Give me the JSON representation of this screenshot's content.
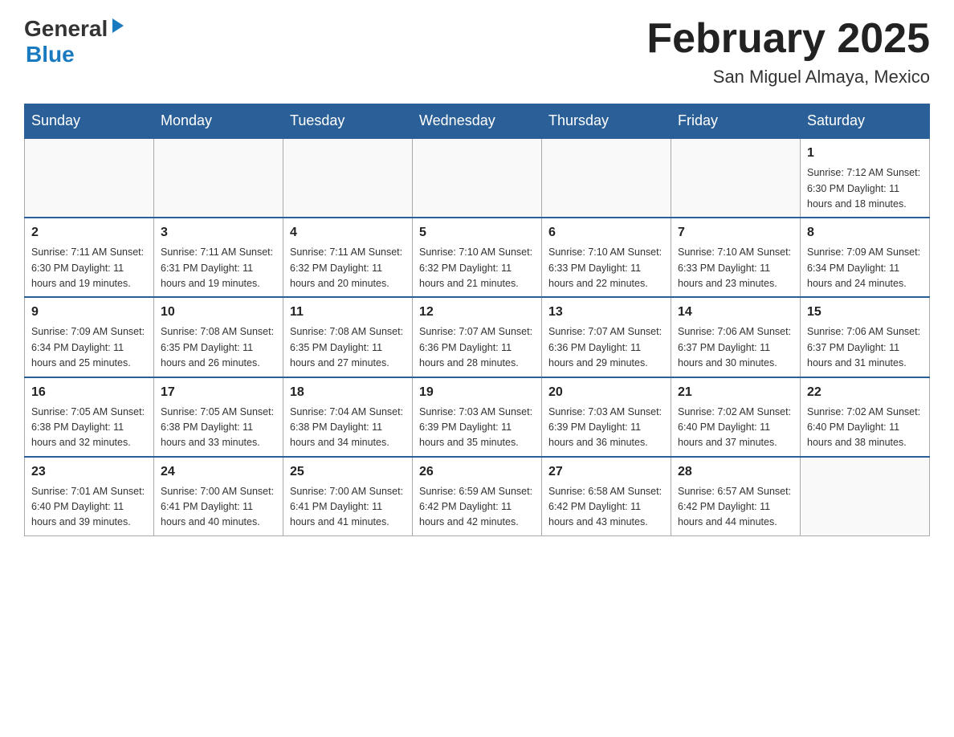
{
  "header": {
    "logo": {
      "general": "General",
      "blue": "Blue"
    },
    "title": "February 2025",
    "location": "San Miguel Almaya, Mexico"
  },
  "days_of_week": [
    "Sunday",
    "Monday",
    "Tuesday",
    "Wednesday",
    "Thursday",
    "Friday",
    "Saturday"
  ],
  "weeks": [
    [
      {
        "day": "",
        "info": ""
      },
      {
        "day": "",
        "info": ""
      },
      {
        "day": "",
        "info": ""
      },
      {
        "day": "",
        "info": ""
      },
      {
        "day": "",
        "info": ""
      },
      {
        "day": "",
        "info": ""
      },
      {
        "day": "1",
        "info": "Sunrise: 7:12 AM\nSunset: 6:30 PM\nDaylight: 11 hours and 18 minutes."
      }
    ],
    [
      {
        "day": "2",
        "info": "Sunrise: 7:11 AM\nSunset: 6:30 PM\nDaylight: 11 hours and 19 minutes."
      },
      {
        "day": "3",
        "info": "Sunrise: 7:11 AM\nSunset: 6:31 PM\nDaylight: 11 hours and 19 minutes."
      },
      {
        "day": "4",
        "info": "Sunrise: 7:11 AM\nSunset: 6:32 PM\nDaylight: 11 hours and 20 minutes."
      },
      {
        "day": "5",
        "info": "Sunrise: 7:10 AM\nSunset: 6:32 PM\nDaylight: 11 hours and 21 minutes."
      },
      {
        "day": "6",
        "info": "Sunrise: 7:10 AM\nSunset: 6:33 PM\nDaylight: 11 hours and 22 minutes."
      },
      {
        "day": "7",
        "info": "Sunrise: 7:10 AM\nSunset: 6:33 PM\nDaylight: 11 hours and 23 minutes."
      },
      {
        "day": "8",
        "info": "Sunrise: 7:09 AM\nSunset: 6:34 PM\nDaylight: 11 hours and 24 minutes."
      }
    ],
    [
      {
        "day": "9",
        "info": "Sunrise: 7:09 AM\nSunset: 6:34 PM\nDaylight: 11 hours and 25 minutes."
      },
      {
        "day": "10",
        "info": "Sunrise: 7:08 AM\nSunset: 6:35 PM\nDaylight: 11 hours and 26 minutes."
      },
      {
        "day": "11",
        "info": "Sunrise: 7:08 AM\nSunset: 6:35 PM\nDaylight: 11 hours and 27 minutes."
      },
      {
        "day": "12",
        "info": "Sunrise: 7:07 AM\nSunset: 6:36 PM\nDaylight: 11 hours and 28 minutes."
      },
      {
        "day": "13",
        "info": "Sunrise: 7:07 AM\nSunset: 6:36 PM\nDaylight: 11 hours and 29 minutes."
      },
      {
        "day": "14",
        "info": "Sunrise: 7:06 AM\nSunset: 6:37 PM\nDaylight: 11 hours and 30 minutes."
      },
      {
        "day": "15",
        "info": "Sunrise: 7:06 AM\nSunset: 6:37 PM\nDaylight: 11 hours and 31 minutes."
      }
    ],
    [
      {
        "day": "16",
        "info": "Sunrise: 7:05 AM\nSunset: 6:38 PM\nDaylight: 11 hours and 32 minutes."
      },
      {
        "day": "17",
        "info": "Sunrise: 7:05 AM\nSunset: 6:38 PM\nDaylight: 11 hours and 33 minutes."
      },
      {
        "day": "18",
        "info": "Sunrise: 7:04 AM\nSunset: 6:38 PM\nDaylight: 11 hours and 34 minutes."
      },
      {
        "day": "19",
        "info": "Sunrise: 7:03 AM\nSunset: 6:39 PM\nDaylight: 11 hours and 35 minutes."
      },
      {
        "day": "20",
        "info": "Sunrise: 7:03 AM\nSunset: 6:39 PM\nDaylight: 11 hours and 36 minutes."
      },
      {
        "day": "21",
        "info": "Sunrise: 7:02 AM\nSunset: 6:40 PM\nDaylight: 11 hours and 37 minutes."
      },
      {
        "day": "22",
        "info": "Sunrise: 7:02 AM\nSunset: 6:40 PM\nDaylight: 11 hours and 38 minutes."
      }
    ],
    [
      {
        "day": "23",
        "info": "Sunrise: 7:01 AM\nSunset: 6:40 PM\nDaylight: 11 hours and 39 minutes."
      },
      {
        "day": "24",
        "info": "Sunrise: 7:00 AM\nSunset: 6:41 PM\nDaylight: 11 hours and 40 minutes."
      },
      {
        "day": "25",
        "info": "Sunrise: 7:00 AM\nSunset: 6:41 PM\nDaylight: 11 hours and 41 minutes."
      },
      {
        "day": "26",
        "info": "Sunrise: 6:59 AM\nSunset: 6:42 PM\nDaylight: 11 hours and 42 minutes."
      },
      {
        "day": "27",
        "info": "Sunrise: 6:58 AM\nSunset: 6:42 PM\nDaylight: 11 hours and 43 minutes."
      },
      {
        "day": "28",
        "info": "Sunrise: 6:57 AM\nSunset: 6:42 PM\nDaylight: 11 hours and 44 minutes."
      },
      {
        "day": "",
        "info": ""
      }
    ]
  ]
}
